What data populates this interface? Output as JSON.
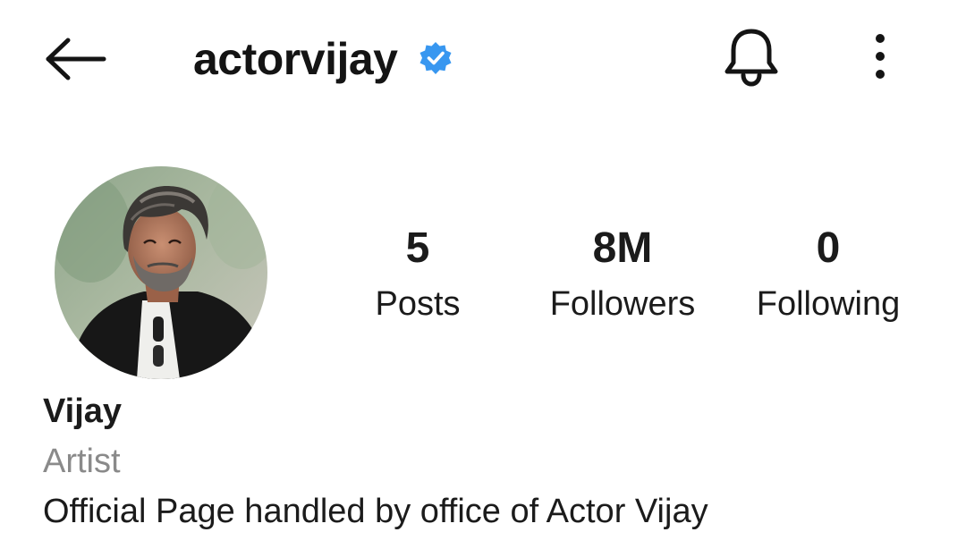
{
  "header": {
    "username": "actorvijay",
    "verified": true,
    "icons": {
      "back": "arrow-left-icon",
      "verified": "verified-badge-icon",
      "notifications": "bell-icon",
      "more": "more-vertical-icon"
    }
  },
  "profile": {
    "avatar_icon": "profile-photo",
    "stats": [
      {
        "value": "5",
        "label": "Posts"
      },
      {
        "value": "8M",
        "label": "Followers"
      },
      {
        "value": "0",
        "label": "Following"
      }
    ],
    "name": "Vijay",
    "category": "Artist",
    "bio": "Official Page handled by office of Actor Vijay"
  },
  "colors": {
    "verified_blue": "#3897f0",
    "text_primary": "#1b1b1b",
    "text_secondary": "#8a8a8a",
    "background": "#ffffff"
  }
}
